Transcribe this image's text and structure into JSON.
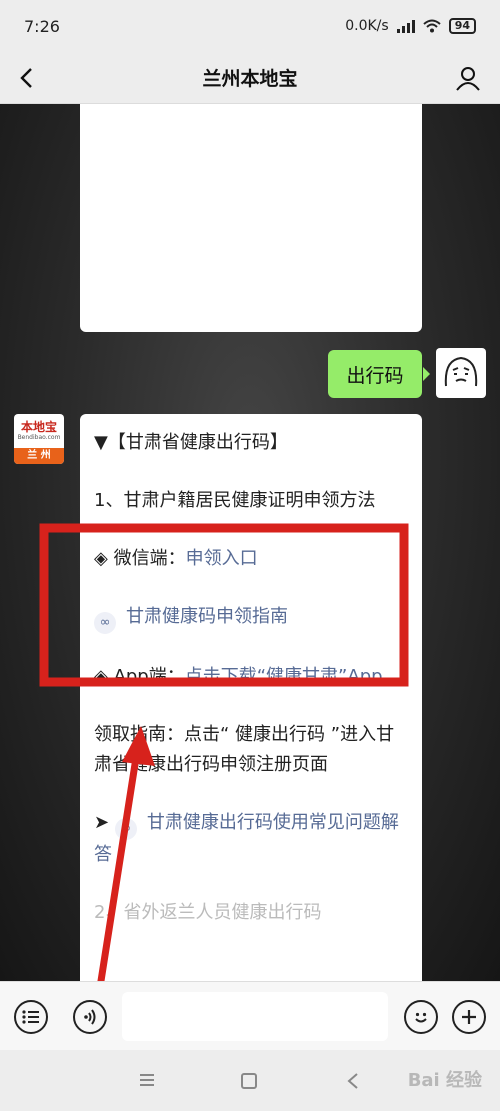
{
  "status": {
    "time": "7:26",
    "speed": "0.0K/s",
    "battery": "94"
  },
  "nav": {
    "title": "兰州本地宝"
  },
  "chat": {
    "user_message": "出行码",
    "bot_avatar": {
      "main": "本地宝",
      "sub": "Bendibao.com",
      "city": "兰 州"
    },
    "reply": {
      "line1": "▼【甘肃省健康出行码】",
      "line2": "1、甘肃户籍居民健康证明申领方法",
      "wechat_prefix": "◈ 微信端：",
      "wechat_link": "申领入口",
      "guide_link": "甘肃健康码申领指南",
      "app_prefix": "◈ App端：",
      "app_link": "点击下载“健康甘肃”App",
      "guide_text": "领取指南：点击“ 健康出行码 ”进入甘肃省健康出行码申领注册页面",
      "faq_prefix": "➤",
      "faq_link": "甘肃健康出行码使用常见问题解答",
      "cut_text": "2、省外返兰人员健康出行码"
    }
  },
  "annotation": {
    "box_color": "#d7221c",
    "arrow_color": "#d7221c"
  },
  "watermark": "Bai 经验"
}
